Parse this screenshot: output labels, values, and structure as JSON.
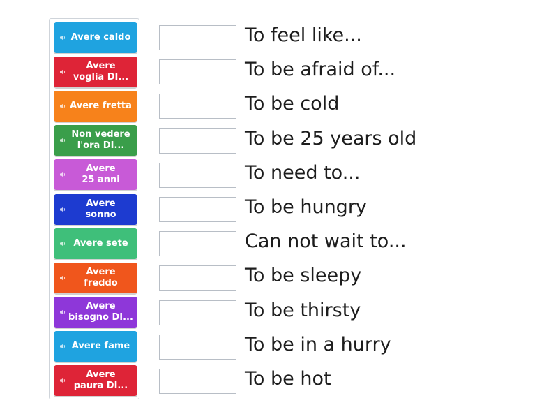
{
  "tiles": [
    {
      "label": "Avere caldo",
      "color": "#1fa3e0"
    },
    {
      "label": "Avere\nvoglia DI...",
      "color": "#de2437"
    },
    {
      "label": "Avere fretta",
      "color": "#f7821b"
    },
    {
      "label": "Non vedere\nl'ora DI...",
      "color": "#3a9e4a"
    },
    {
      "label": "Avere\n25 anni",
      "color": "#c85ad7"
    },
    {
      "label": "Avere\nsonno",
      "color": "#1d3bd0"
    },
    {
      "label": "Avere sete",
      "color": "#3fbf7a"
    },
    {
      "label": "Avere\nfreddo",
      "color": "#f0561c"
    },
    {
      "label": "Avere\nbisogno DI...",
      "color": "#8e37d9"
    },
    {
      "label": "Avere fame",
      "color": "#1fa3e0"
    },
    {
      "label": "Avere\npaura DI...",
      "color": "#de2437"
    }
  ],
  "definitions": [
    "To feel like...",
    "To be afraid of...",
    "To be cold",
    "To be 25 years old",
    "To need to...",
    "To be hungry",
    "Can not wait to...",
    "To be sleepy",
    "To be thirsty",
    "To be in a hurry",
    "To be hot"
  ],
  "icon": "speaker-icon"
}
